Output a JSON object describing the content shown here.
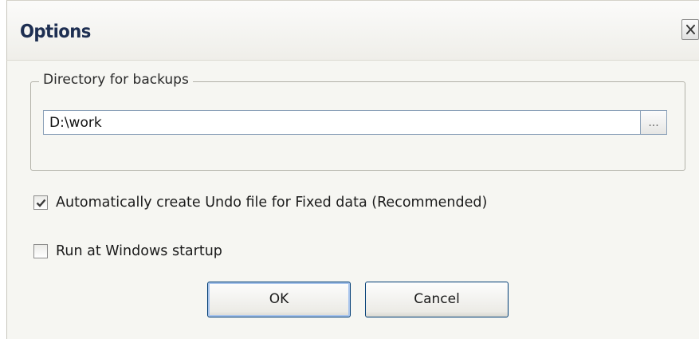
{
  "dialog": {
    "title": "Options",
    "close_glyph": "X"
  },
  "backup": {
    "group_label": "Directory for backups",
    "path_value": "D:\\work",
    "browse_label": "..."
  },
  "options": {
    "undo_label": "Automatically create Undo file for Fixed data (Recommended)",
    "undo_checked": true,
    "startup_label": "Run at Windows startup",
    "startup_checked": false
  },
  "buttons": {
    "ok_label": "OK",
    "cancel_label": "Cancel"
  },
  "colors": {
    "title": "#1e2f52",
    "button_border": "#003c74",
    "focus_ring": "#a8c4ec",
    "panel_bg": "#f6f6f2"
  },
  "icons": {
    "close": "close-icon",
    "check": "check-icon"
  }
}
